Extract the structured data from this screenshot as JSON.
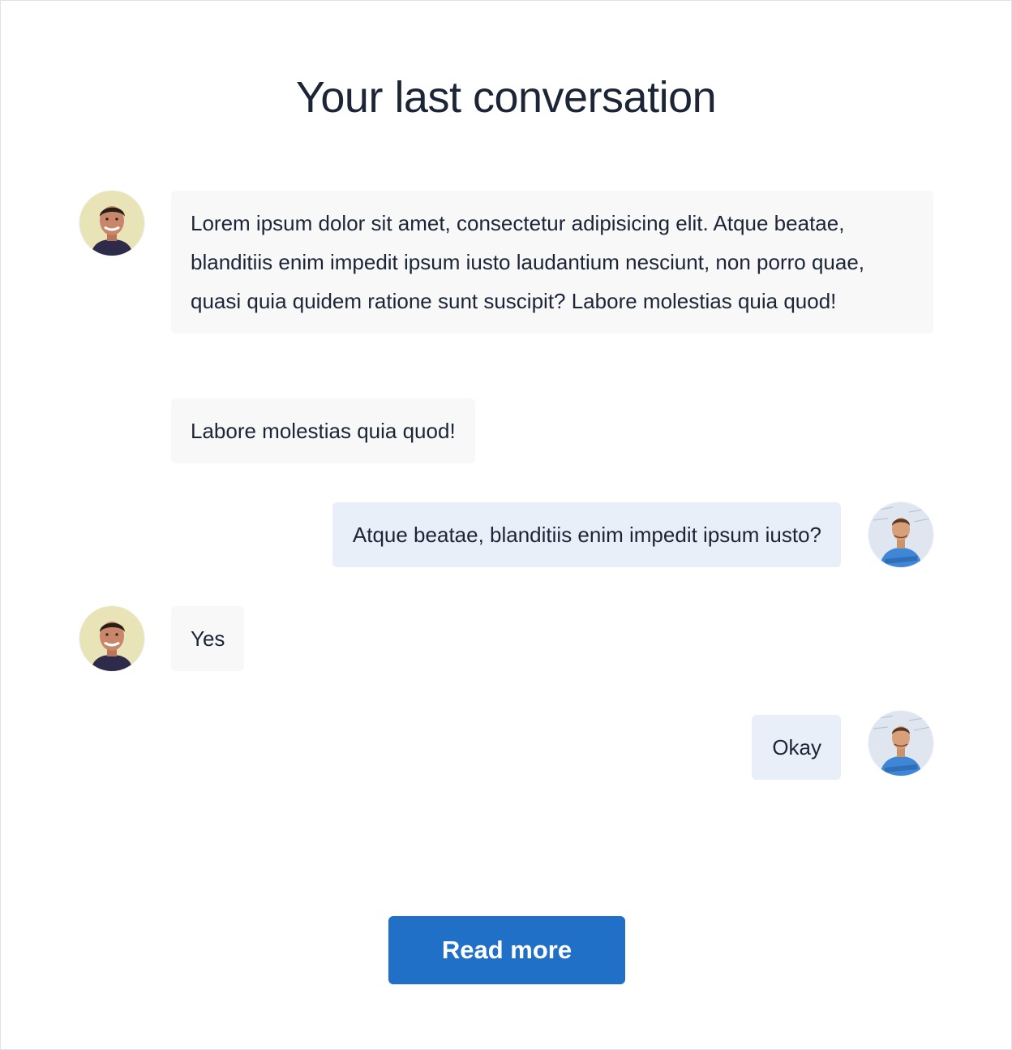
{
  "page": {
    "title": "Your last conversation",
    "read_more_label": "Read more",
    "accent_color": "#2170c8",
    "incoming_bubble_color": "#f8f8f8",
    "outgoing_bubble_color": "#e9eff9"
  },
  "messages": [
    {
      "sender": "incoming",
      "avatar": "contact-avatar",
      "text": "Lorem ipsum dolor sit amet, consectetur adipisicing elit. Atque beatae, blanditiis enim impedit ipsum iusto laudantium nesciunt, non porro quae, quasi quia quidem ratione sunt suscipit? Labore molestias quia quod!"
    },
    {
      "sender": "incoming",
      "avatar": null,
      "text": "Labore molestias quia quod!"
    },
    {
      "sender": "outgoing",
      "avatar": "user-avatar",
      "text": "Atque beatae, blanditiis enim impedit ipsum iusto?"
    },
    {
      "sender": "incoming",
      "avatar": "contact-avatar",
      "text": "Yes"
    },
    {
      "sender": "outgoing",
      "avatar": "user-avatar",
      "text": "Okay"
    }
  ]
}
